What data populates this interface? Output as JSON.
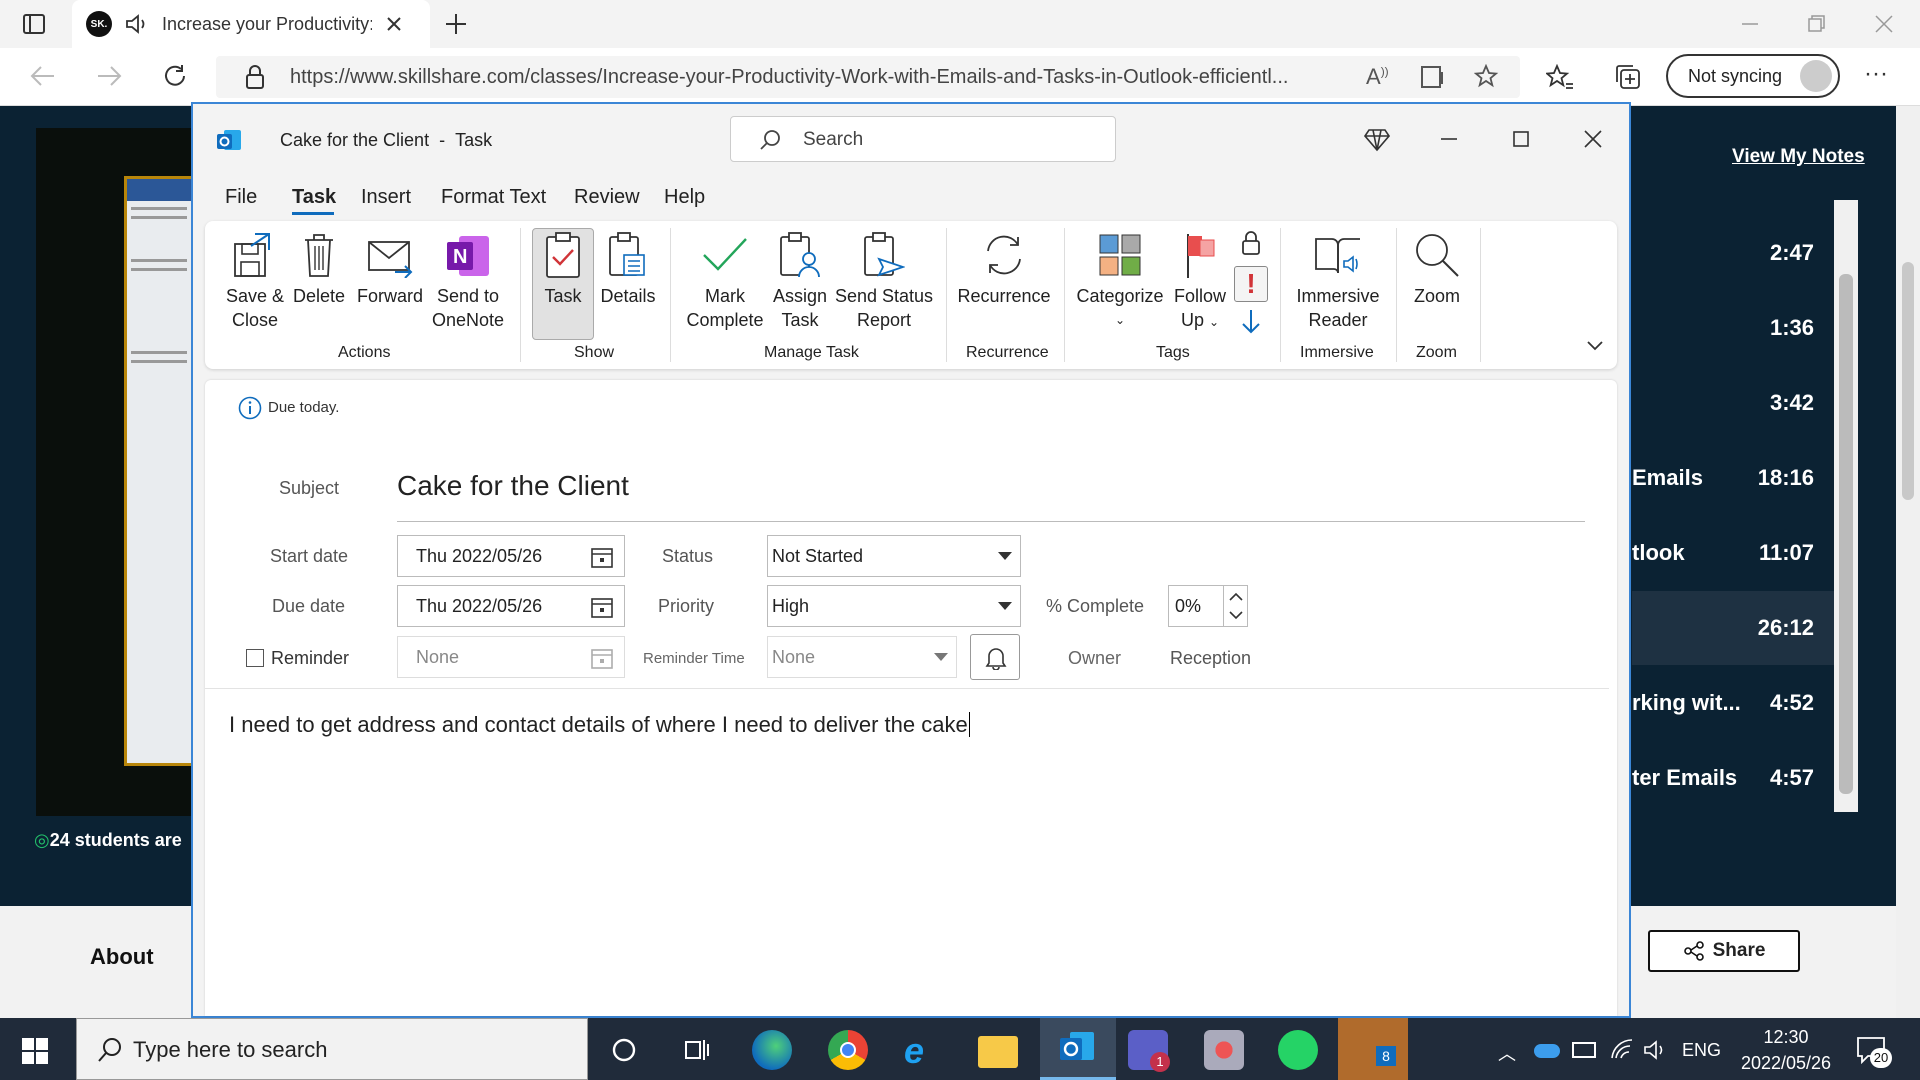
{
  "browser": {
    "tab_title": "Increase your Productivity: W",
    "url": "https://www.skillshare.com/classes/Increase-your-Productivity-Work-with-Emails-and-Tasks-in-Outlook-efficientl...",
    "sync_label": "Not syncing",
    "favicon_text": "SK."
  },
  "page": {
    "view_notes": "View My Notes",
    "students": "24 students are",
    "about": "About",
    "share": "Share",
    "lessons": [
      {
        "title": "",
        "duration": "2:47"
      },
      {
        "title": "",
        "duration": "1:36"
      },
      {
        "title": "",
        "duration": "3:42"
      },
      {
        "title": "Emails",
        "duration": "18:16"
      },
      {
        "title": "tlook",
        "duration": "11:07"
      },
      {
        "title": "",
        "duration": "26:12"
      },
      {
        "title": "rking wit...",
        "duration": "4:52"
      },
      {
        "title": "ter Emails",
        "duration": "4:57"
      }
    ]
  },
  "outlook": {
    "title": "Cake for the Client",
    "title_type": "Task",
    "search_placeholder": "Search",
    "menu": [
      "File",
      "Task",
      "Insert",
      "Format Text",
      "Review",
      "Help"
    ],
    "ribbon": {
      "save_close_1": "Save &",
      "save_close_2": "Close",
      "delete": "Delete",
      "forward": "Forward",
      "onenote_1": "Send to",
      "onenote_2": "OneNote",
      "task": "Task",
      "details": "Details",
      "mark_1": "Mark",
      "mark_2": "Complete",
      "assign_1": "Assign",
      "assign_2": "Task",
      "status_1": "Send Status",
      "status_2": "Report",
      "recurrence": "Recurrence",
      "categorize": "Categorize",
      "follow_1": "Follow",
      "follow_2": "Up",
      "immersive_1": "Immersive",
      "immersive_2": "Reader",
      "zoom": "Zoom",
      "groups": {
        "actions": "Actions",
        "show": "Show",
        "manage": "Manage Task",
        "recurrence": "Recurrence",
        "tags": "Tags",
        "immersive": "Immersive",
        "zoom": "Zoom"
      }
    },
    "form": {
      "due_info": "Due today.",
      "subject_label": "Subject",
      "subject": "Cake for the Client",
      "start_label": "Start date",
      "start": "Thu 2022/05/26",
      "due_label": "Due date",
      "due": "Thu 2022/05/26",
      "reminder_label": "Reminder",
      "reminder_date": "None",
      "reminder_time_label": "Reminder Time",
      "reminder_time": "None",
      "status_label": "Status",
      "status": "Not Started",
      "priority_label": "Priority",
      "priority": "High",
      "complete_label": "% Complete",
      "complete": "0%",
      "owner_label": "Owner",
      "owner": "Reception",
      "body": "I need to get address and contact details of where I need to deliver the cake"
    }
  },
  "taskbar": {
    "search_placeholder": "Type here to search",
    "lang": "ENG",
    "time": "12:30",
    "date": "2022/05/26",
    "notif_count": "20",
    "teams_badge": "1",
    "app_badge": "8"
  },
  "colors": {
    "outlook_blue": "#0f6cbd",
    "page_dark": "#0b2233",
    "taskbar": "#202b3a",
    "accent_green": "#23c26b"
  }
}
